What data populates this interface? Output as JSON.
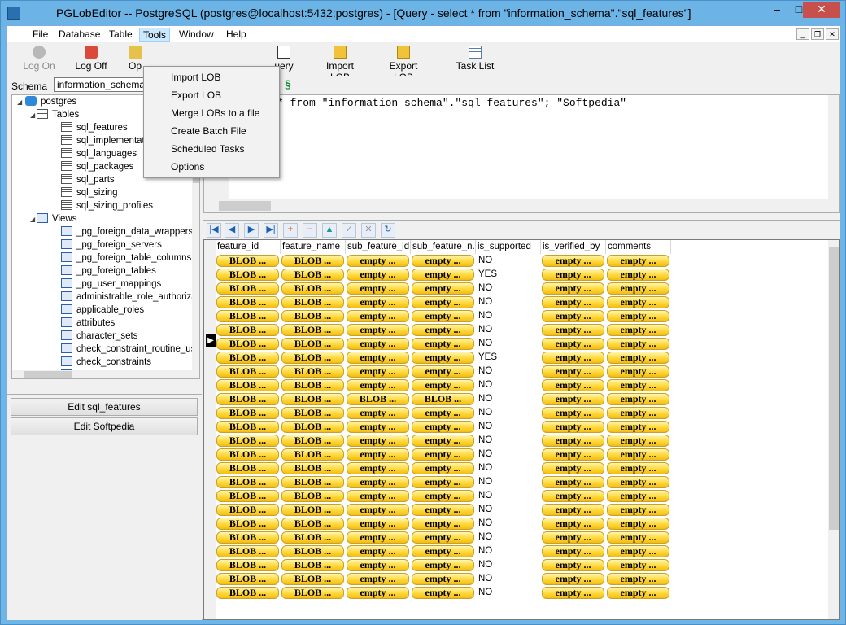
{
  "window": {
    "title": "PGLobEditor -- PostgreSQL (postgres@localhost:5432:postgres) - [Query - select * from \"information_schema\".\"sql_features\"]",
    "minimize": "–",
    "maximize": "□",
    "close": "✕"
  },
  "menubar": {
    "items": [
      "File",
      "Database",
      "Table",
      "Tools",
      "Window",
      "Help"
    ],
    "active": "Tools"
  },
  "toolbar": {
    "log_on": "Log On",
    "log_off": "Log Off",
    "open": "Op",
    "query": "uery",
    "import_lob": "Import LOB",
    "export_lob": "Export LOB",
    "task_list": "Task List"
  },
  "tools_menu": {
    "items": [
      "Import LOB",
      "Export LOB",
      "Merge LOBs to a file",
      "Create Batch File",
      "Scheduled Tasks",
      "Options"
    ]
  },
  "schema": {
    "label": "Schema",
    "value": "information_schema"
  },
  "tree": {
    "root": "postgres",
    "tables_label": "Tables",
    "tables": [
      "sql_features",
      "sql_implementat",
      "sql_languages",
      "sql_packages",
      "sql_parts",
      "sql_sizing",
      "sql_sizing_profiles"
    ],
    "views_label": "Views",
    "views": [
      "_pg_foreign_data_wrappers",
      "_pg_foreign_servers",
      "_pg_foreign_table_columns",
      "_pg_foreign_tables",
      "_pg_user_mappings",
      "administrable_role_authoriza",
      "applicable_roles",
      "attributes",
      "character_sets",
      "check_constraint_routine_us",
      "check_constraints",
      "collation_character_set_app"
    ]
  },
  "left_buttons": {
    "edit_table": "Edit sql_features",
    "edit_softpedia": "Edit Softpedia"
  },
  "editor": {
    "sql": "* from \"information_schema\".\"sql_features\"; \"Softpedia\""
  },
  "grid": {
    "columns": [
      "feature_id",
      "feature_name",
      "sub_feature_id",
      "sub_feature_n...",
      "is_supported",
      "is_verified_by",
      "comments"
    ],
    "rows": [
      [
        "BLOB ...",
        "BLOB ...",
        "empty ...",
        "empty ...",
        "NO",
        "empty ...",
        "empty ..."
      ],
      [
        "BLOB ...",
        "BLOB ...",
        "empty ...",
        "empty ...",
        "YES",
        "empty ...",
        "empty ..."
      ],
      [
        "BLOB ...",
        "BLOB ...",
        "empty ...",
        "empty ...",
        "NO",
        "empty ...",
        "empty ..."
      ],
      [
        "BLOB ...",
        "BLOB ...",
        "empty ...",
        "empty ...",
        "NO",
        "empty ...",
        "empty ..."
      ],
      [
        "BLOB ...",
        "BLOB ...",
        "empty ...",
        "empty ...",
        "NO",
        "empty ...",
        "empty ..."
      ],
      [
        "BLOB ...",
        "BLOB ...",
        "empty ...",
        "empty ...",
        "NO",
        "empty ...",
        "empty ..."
      ],
      [
        "BLOB ...",
        "BLOB ...",
        "empty ...",
        "empty ...",
        "NO",
        "empty ...",
        "empty ..."
      ],
      [
        "BLOB ...",
        "BLOB ...",
        "empty ...",
        "empty ...",
        "YES",
        "empty ...",
        "empty ..."
      ],
      [
        "BLOB ...",
        "BLOB ...",
        "empty ...",
        "empty ...",
        "NO",
        "empty ...",
        "empty ..."
      ],
      [
        "BLOB ...",
        "BLOB ...",
        "empty ...",
        "empty ...",
        "NO",
        "empty ...",
        "empty ..."
      ],
      [
        "BLOB ...",
        "BLOB ...",
        "BLOB ...",
        "BLOB ...",
        "NO",
        "empty ...",
        "empty ..."
      ],
      [
        "BLOB ...",
        "BLOB ...",
        "empty ...",
        "empty ...",
        "NO",
        "empty ...",
        "empty ..."
      ],
      [
        "BLOB ...",
        "BLOB ...",
        "empty ...",
        "empty ...",
        "NO",
        "empty ...",
        "empty ..."
      ],
      [
        "BLOB ...",
        "BLOB ...",
        "empty ...",
        "empty ...",
        "NO",
        "empty ...",
        "empty ..."
      ],
      [
        "BLOB ...",
        "BLOB ...",
        "empty ...",
        "empty ...",
        "NO",
        "empty ...",
        "empty ..."
      ],
      [
        "BLOB ...",
        "BLOB ...",
        "empty ...",
        "empty ...",
        "NO",
        "empty ...",
        "empty ..."
      ],
      [
        "BLOB ...",
        "BLOB ...",
        "empty ...",
        "empty ...",
        "NO",
        "empty ...",
        "empty ..."
      ],
      [
        "BLOB ...",
        "BLOB ...",
        "empty ...",
        "empty ...",
        "NO",
        "empty ...",
        "empty ..."
      ],
      [
        "BLOB ...",
        "BLOB ...",
        "empty ...",
        "empty ...",
        "NO",
        "empty ...",
        "empty ..."
      ],
      [
        "BLOB ...",
        "BLOB ...",
        "empty ...",
        "empty ...",
        "NO",
        "empty ...",
        "empty ..."
      ],
      [
        "BLOB ...",
        "BLOB ...",
        "empty ...",
        "empty ...",
        "NO",
        "empty ...",
        "empty ..."
      ],
      [
        "BLOB ...",
        "BLOB ...",
        "empty ...",
        "empty ...",
        "NO",
        "empty ...",
        "empty ..."
      ],
      [
        "BLOB ...",
        "BLOB ...",
        "empty ...",
        "empty ...",
        "NO",
        "empty ...",
        "empty ..."
      ],
      [
        "BLOB ...",
        "BLOB ...",
        "empty ...",
        "empty ...",
        "NO",
        "empty ...",
        "empty ..."
      ],
      [
        "BLOB ...",
        "BLOB ...",
        "empty ...",
        "empty ...",
        "NO",
        "empty ...",
        "empty ..."
      ]
    ]
  },
  "colors": {
    "titlebar": "#6db4e6",
    "close_button": "#c7504c",
    "pill": "#ffd83a"
  }
}
